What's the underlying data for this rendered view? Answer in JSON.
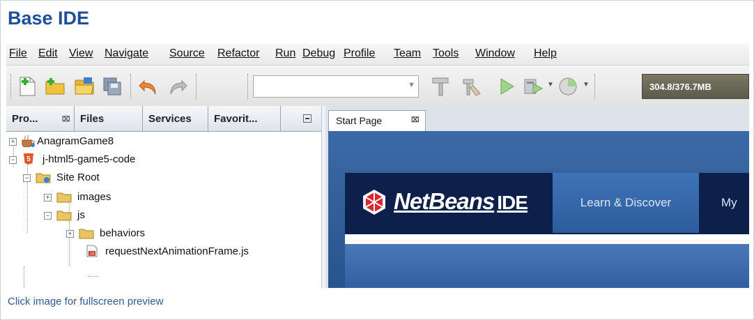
{
  "page": {
    "title": "Base IDE",
    "caption": "Click image for fullscreen preview"
  },
  "menubar": [
    "File",
    "Edit",
    "View",
    "Navigate",
    "Source",
    "Refactor",
    "Run",
    "Debug",
    "Profile",
    "Team",
    "Tools",
    "Window",
    "Help"
  ],
  "toolbar": {
    "config_value": "",
    "memory": "304.8/376.7MB"
  },
  "projects_panel": {
    "tabs": [
      "Pro...",
      "Files",
      "Services",
      "Favorit..."
    ],
    "tree": [
      {
        "label": "AnagramGame8"
      },
      {
        "label": "j-html5-game5-code"
      },
      {
        "label": "Site Root"
      },
      {
        "label": "images"
      },
      {
        "label": "js"
      },
      {
        "label": "behaviors"
      },
      {
        "label": "requestNextAnimationFrame.js"
      }
    ]
  },
  "editor": {
    "tab": "Start Page",
    "start_page": {
      "logo": "NetBeans",
      "logo_suffix": "IDE",
      "nav_learn": "Learn & Discover",
      "nav_my": "My"
    }
  },
  "colors": {
    "title": "#1f4e9c",
    "caption": "#2f5b95",
    "header_dark": "#0d1f4b",
    "accent_blue": "#3f73b7"
  }
}
